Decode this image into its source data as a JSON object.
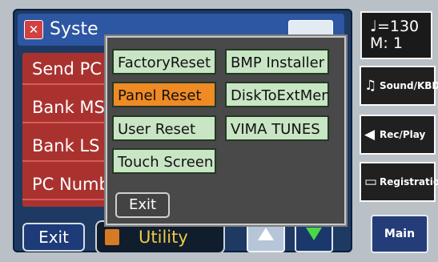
{
  "title": {
    "text": "Syste",
    "icon": "system-icon"
  },
  "params": [
    {
      "label": "Send PC"
    },
    {
      "label": "Bank MS"
    },
    {
      "label": "Bank LS"
    },
    {
      "label": "PC Numb"
    }
  ],
  "footer": {
    "exit_label": "Exit",
    "utility_label": "Utility",
    "up_icon": "arrow-up-icon",
    "down_icon": "arrow-down-icon"
  },
  "popup": {
    "items": [
      {
        "label": "FactoryReset",
        "active": false
      },
      {
        "label": "BMP Installer",
        "active": false
      },
      {
        "label": "Panel Reset",
        "active": true
      },
      {
        "label": "DiskToExtMem",
        "active": false
      },
      {
        "label": "User Reset",
        "active": false
      },
      {
        "label": "VIMA TUNES",
        "active": false
      },
      {
        "label": "Touch Screen",
        "active": false
      }
    ],
    "exit_label": "Exit"
  },
  "tempo": {
    "line1": "♩=130",
    "line2": "M:   1"
  },
  "side": {
    "sound_kbd": "Sound/KBD",
    "rec_play": "Rec/Play",
    "registration": "Registration",
    "main": "Main"
  },
  "colors": {
    "active_menu": "#ef8a25",
    "menu_bg": "#c8e5c4",
    "param_bg": "#a9322f",
    "screen_bg": "#1e3a63",
    "utility_text": "#f0c947"
  }
}
